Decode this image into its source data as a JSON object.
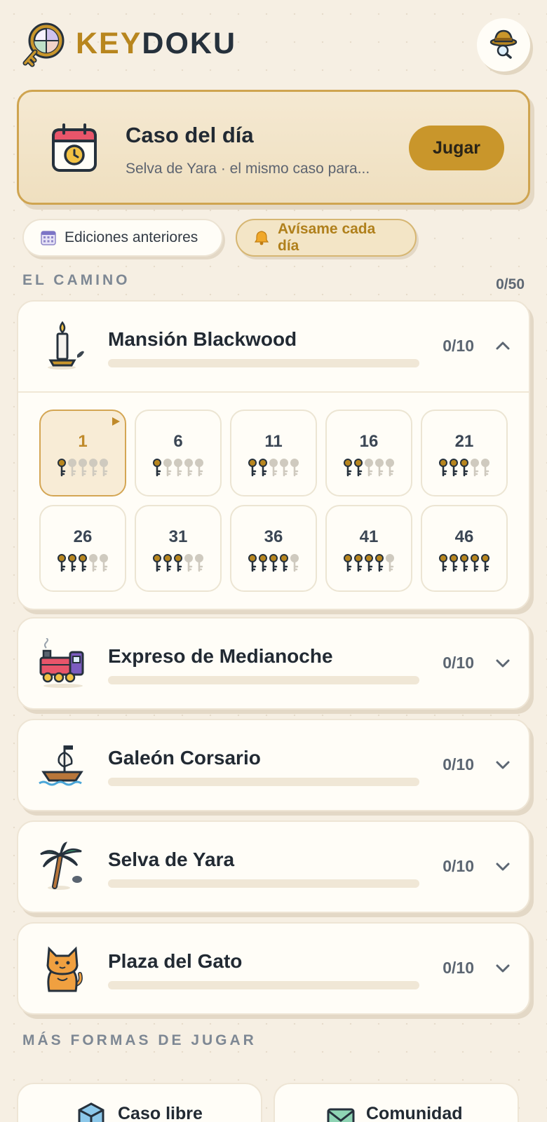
{
  "app": {
    "name_part1": "KEY",
    "name_part2": "DOKU"
  },
  "daily": {
    "title": "Caso del día",
    "subtitle": "Selva de Yara · el mismo caso para...",
    "play_label": "Jugar"
  },
  "chips": {
    "previous": "Ediciones anteriores",
    "notify": "Avísame cada día"
  },
  "path": {
    "label": "EL CAMINO",
    "progress": "0/50"
  },
  "worlds": [
    {
      "name": "Mansión Blackwood",
      "count": "0/10",
      "progress": 0,
      "icon": "candle-icon",
      "expanded": true
    },
    {
      "name": "Expreso de Medianoche",
      "count": "0/10",
      "progress": 0,
      "icon": "train-icon",
      "expanded": false
    },
    {
      "name": "Galeón Corsario",
      "count": "0/10",
      "progress": 0,
      "icon": "ship-icon",
      "expanded": false
    },
    {
      "name": "Selva de Yara",
      "count": "0/10",
      "progress": 0,
      "icon": "palm-tree-icon",
      "expanded": false
    },
    {
      "name": "Plaza del Gato",
      "count": "0/10",
      "progress": 0,
      "icon": "cat-icon",
      "expanded": false
    }
  ],
  "levels": [
    {
      "num": "1",
      "keys": 1,
      "current": true
    },
    {
      "num": "6",
      "keys": 1,
      "current": false
    },
    {
      "num": "11",
      "keys": 2,
      "current": false
    },
    {
      "num": "16",
      "keys": 2,
      "current": false
    },
    {
      "num": "21",
      "keys": 3,
      "current": false
    },
    {
      "num": "26",
      "keys": 3,
      "current": false
    },
    {
      "num": "31",
      "keys": 3,
      "current": false
    },
    {
      "num": "36",
      "keys": 4,
      "current": false
    },
    {
      "num": "41",
      "keys": 4,
      "current": false
    },
    {
      "num": "46",
      "keys": 5,
      "current": false
    }
  ],
  "more": {
    "label": "MÁS FORMAS DE JUGAR",
    "free_case": "Caso libre",
    "community": "Comunidad"
  },
  "colors": {
    "accent": "#c9962b",
    "key_filled": "#b8861e",
    "key_empty": "#cfcabf"
  }
}
